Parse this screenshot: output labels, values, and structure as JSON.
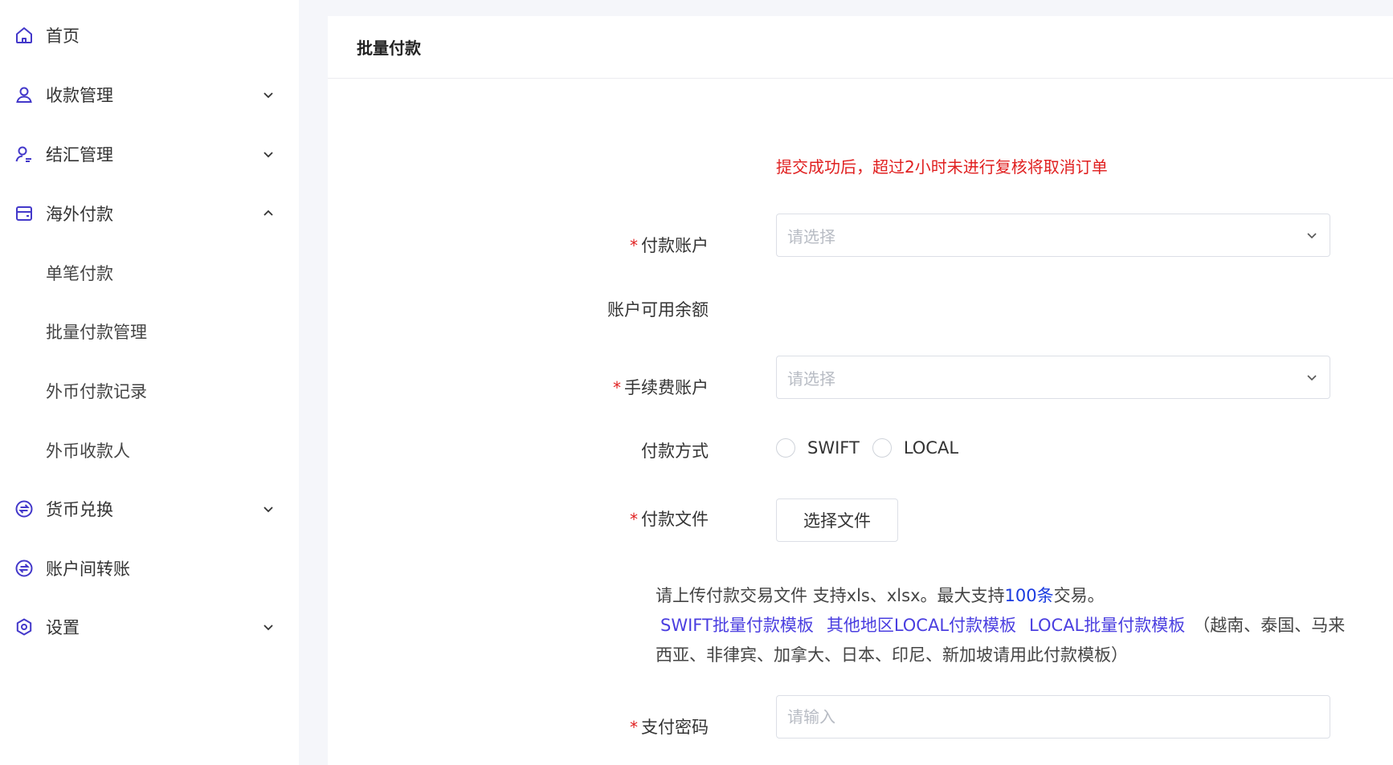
{
  "sidebar": {
    "items": [
      {
        "label": "首页",
        "icon": "home-icon"
      },
      {
        "label": "收款管理",
        "icon": "user-icon"
      },
      {
        "label": "结汇管理",
        "icon": "user-edit-icon"
      },
      {
        "label": "海外付款",
        "icon": "wallet-icon"
      },
      {
        "label": "单笔付款"
      },
      {
        "label": "批量付款管理"
      },
      {
        "label": "外币付款记录"
      },
      {
        "label": "外币收款人"
      },
      {
        "label": "货币兑换",
        "icon": "exchange-icon"
      },
      {
        "label": "账户间转账",
        "icon": "transfer-icon"
      },
      {
        "label": "设置",
        "icon": "settings-icon"
      }
    ]
  },
  "main": {
    "title": "批量付款",
    "notice": "提交成功后，超过2小时未进行复核将取消订单",
    "form": {
      "required_mark": "*",
      "payment_account_label": "付款账户",
      "payment_account_placeholder": "请选择",
      "balance_label": "账户可用余额",
      "fee_account_label": "手续费账户",
      "fee_account_placeholder": "请选择",
      "payment_method_label": "付款方式",
      "payment_methods": [
        "SWIFT",
        "LOCAL"
      ],
      "payment_file_label": "付款文件",
      "choose_file_button": "选择文件",
      "help_text_prefix": "请上传付款交易文件 支持xls、xlsx。最大支持",
      "help_text_highlight": "100条",
      "help_text_suffix": "交易。",
      "template_links": [
        "SWIFT批量付款模板",
        "其他地区LOCAL付款模板",
        "LOCAL批量付款模板"
      ],
      "template_note": "（越南、泰国、马来西亚、非律宾、加拿大、日本、印尼、新加坡请用此付款模板）",
      "pay_password_label": "支付密码",
      "pay_password_placeholder": "请输入"
    }
  },
  "colors": {
    "accent": "#4a3ee0",
    "required": "#e02020",
    "icon": "#4338ca"
  }
}
